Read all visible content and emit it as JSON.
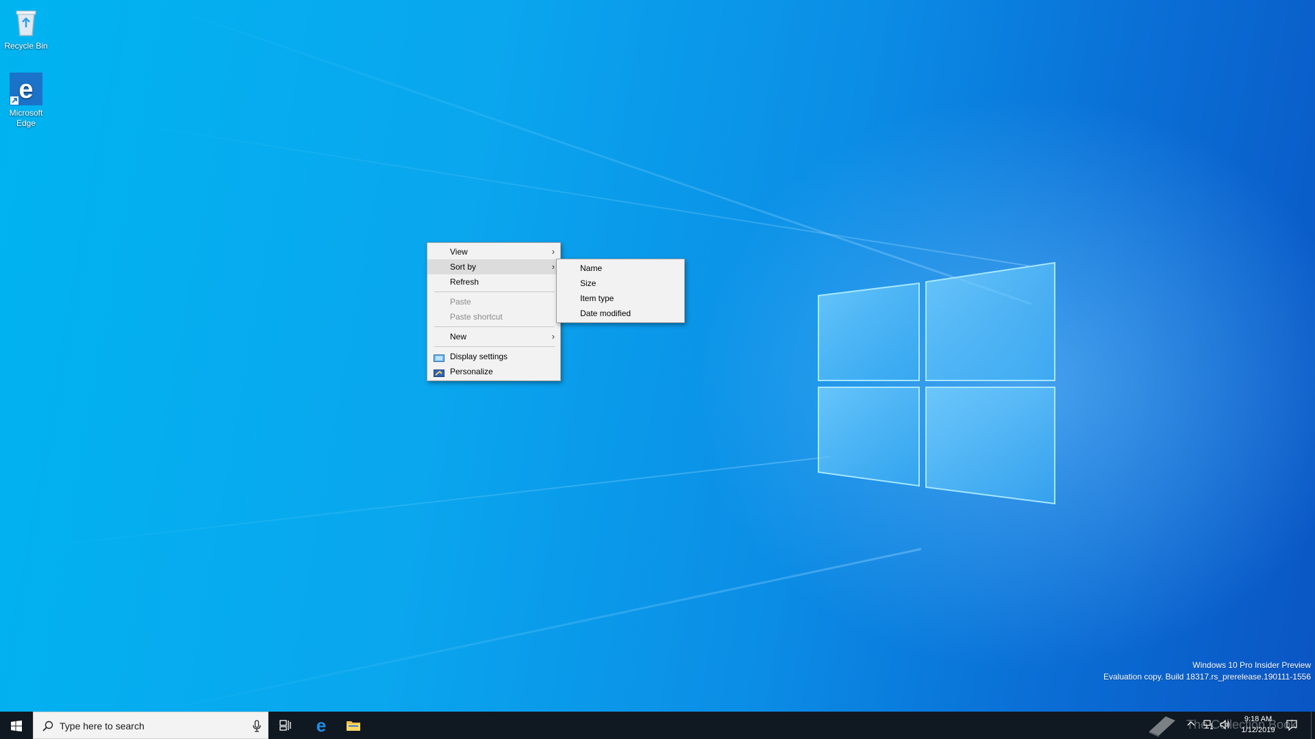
{
  "desktop_icons": [
    {
      "label": "Recycle Bin",
      "icon": "recycle-bin-icon"
    },
    {
      "label": "Microsoft Edge",
      "icon": "edge-icon"
    }
  ],
  "context_menu": {
    "items": [
      {
        "label": "View",
        "submenu": true
      },
      {
        "label": "Sort by",
        "submenu": true,
        "highlighted": true
      },
      {
        "label": "Refresh"
      },
      {
        "label": "Paste",
        "disabled": true
      },
      {
        "label": "Paste shortcut",
        "disabled": true
      },
      {
        "label": "New",
        "submenu": true
      },
      {
        "label": "Display settings",
        "icon": "display-settings-icon"
      },
      {
        "label": "Personalize",
        "icon": "personalize-icon"
      }
    ]
  },
  "sort_submenu": {
    "items": [
      "Name",
      "Size",
      "Item type",
      "Date modified"
    ]
  },
  "taskbar": {
    "search_placeholder": "Type here to search",
    "clock_time": "9:18 AM",
    "clock_date": "1/12/2019"
  },
  "watermark": {
    "edition": "Windows 10 Pro Insider Preview",
    "build": "Evaluation copy. Build 18317.rs_prerelease.190111-1556",
    "site": "The Collection Book"
  },
  "colors": {
    "desktop_accent": "#0a8ee6",
    "taskbar": "#101822",
    "menu_bg": "#f2f2f2"
  }
}
